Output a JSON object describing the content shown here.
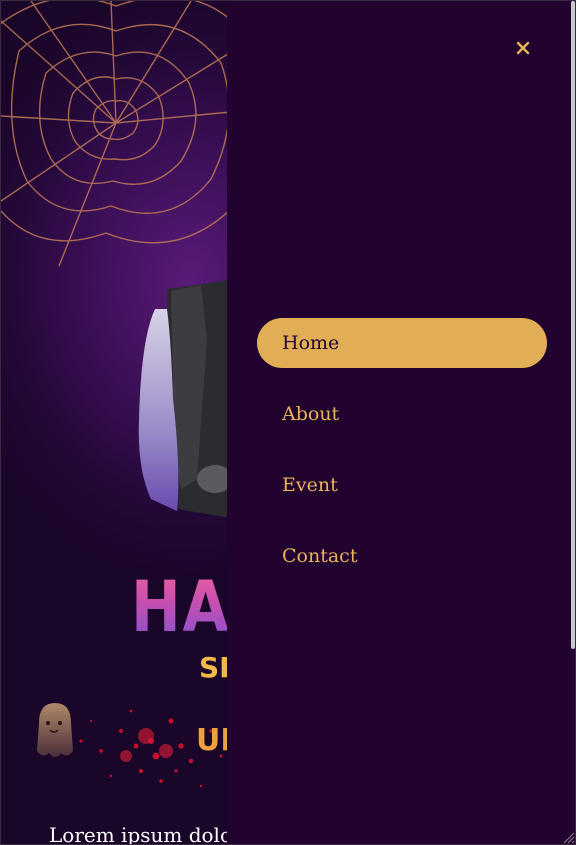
{
  "hero": {
    "title_fragment": "HAL",
    "subtitle_fragment": "SP",
    "tagline_fragment": "UP",
    "body_text": "Lorem ipsum dolor"
  },
  "drawer": {
    "close_icon": "close-icon",
    "items": [
      {
        "label": "Home",
        "active": true
      },
      {
        "label": "About",
        "active": false
      },
      {
        "label": "Event",
        "active": false
      },
      {
        "label": "Contact",
        "active": false
      }
    ]
  },
  "colors": {
    "drawer_bg": "#22022f",
    "accent": "#e1ad55",
    "link": "#eab45a"
  }
}
